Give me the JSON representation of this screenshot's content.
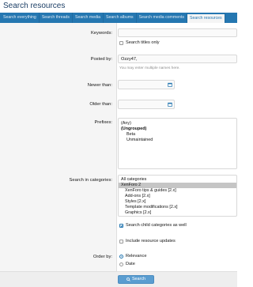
{
  "page": {
    "title": "Search resources"
  },
  "tabs": [
    {
      "label": "Search everything",
      "active": false
    },
    {
      "label": "Search threads",
      "active": false
    },
    {
      "label": "Search media",
      "active": false
    },
    {
      "label": "Search albums",
      "active": false
    },
    {
      "label": "Search media comments",
      "active": false
    },
    {
      "label": "Search resources",
      "active": true
    }
  ],
  "form": {
    "keywords": {
      "label": "Keywords:",
      "value": ""
    },
    "titles_only": {
      "label": "Search titles only",
      "checked": false
    },
    "posted_by": {
      "label": "Posted by:",
      "value": "Ozzy47,",
      "hint": "You may enter multiple names here."
    },
    "newer_than": {
      "label": "Newer than:",
      "value": ""
    },
    "older_than": {
      "label": "Older than:",
      "value": ""
    },
    "prefixes": {
      "label": "Prefixes:",
      "options": [
        {
          "label": "(Any)",
          "bold": false,
          "indent": 0,
          "selected": false
        },
        {
          "label": "(Ungrouped)",
          "bold": true,
          "indent": 0,
          "selected": false
        },
        {
          "label": "Beta",
          "bold": false,
          "indent": 1,
          "selected": false
        },
        {
          "label": "Unmaintained",
          "bold": false,
          "indent": 1,
          "selected": false
        }
      ]
    },
    "categories": {
      "label": "Search in categories:",
      "options": [
        {
          "label": "All categories",
          "indent": 0,
          "selected": false
        },
        {
          "label": "XenForo 2",
          "indent": 0,
          "selected": true
        },
        {
          "label": "XenForo tips & guides [2.x]",
          "indent": 1,
          "selected": false
        },
        {
          "label": "Add-ons [2.x]",
          "indent": 1,
          "selected": false
        },
        {
          "label": "Styles [2.x]",
          "indent": 1,
          "selected": false
        },
        {
          "label": "Template modifications [2.x]",
          "indent": 1,
          "selected": false
        },
        {
          "label": "Graphics [2.x]",
          "indent": 1,
          "selected": false
        }
      ]
    },
    "child_categories": {
      "label": "Search child categories as well",
      "checked": true
    },
    "include_updates": {
      "label": "Include resource updates",
      "checked": false
    },
    "order_by": {
      "label": "Order by:",
      "options": [
        {
          "label": "Relevance",
          "checked": true
        },
        {
          "label": "Date",
          "checked": false
        }
      ]
    },
    "submit": {
      "label": "Search"
    }
  },
  "colors": {
    "accent": "#2577b1",
    "title": "#1d3f66",
    "button": "#5a9dd0",
    "selected_option": "#c5c5c5"
  },
  "icons": {
    "calendar": "calendar-icon",
    "search": "search-icon"
  }
}
